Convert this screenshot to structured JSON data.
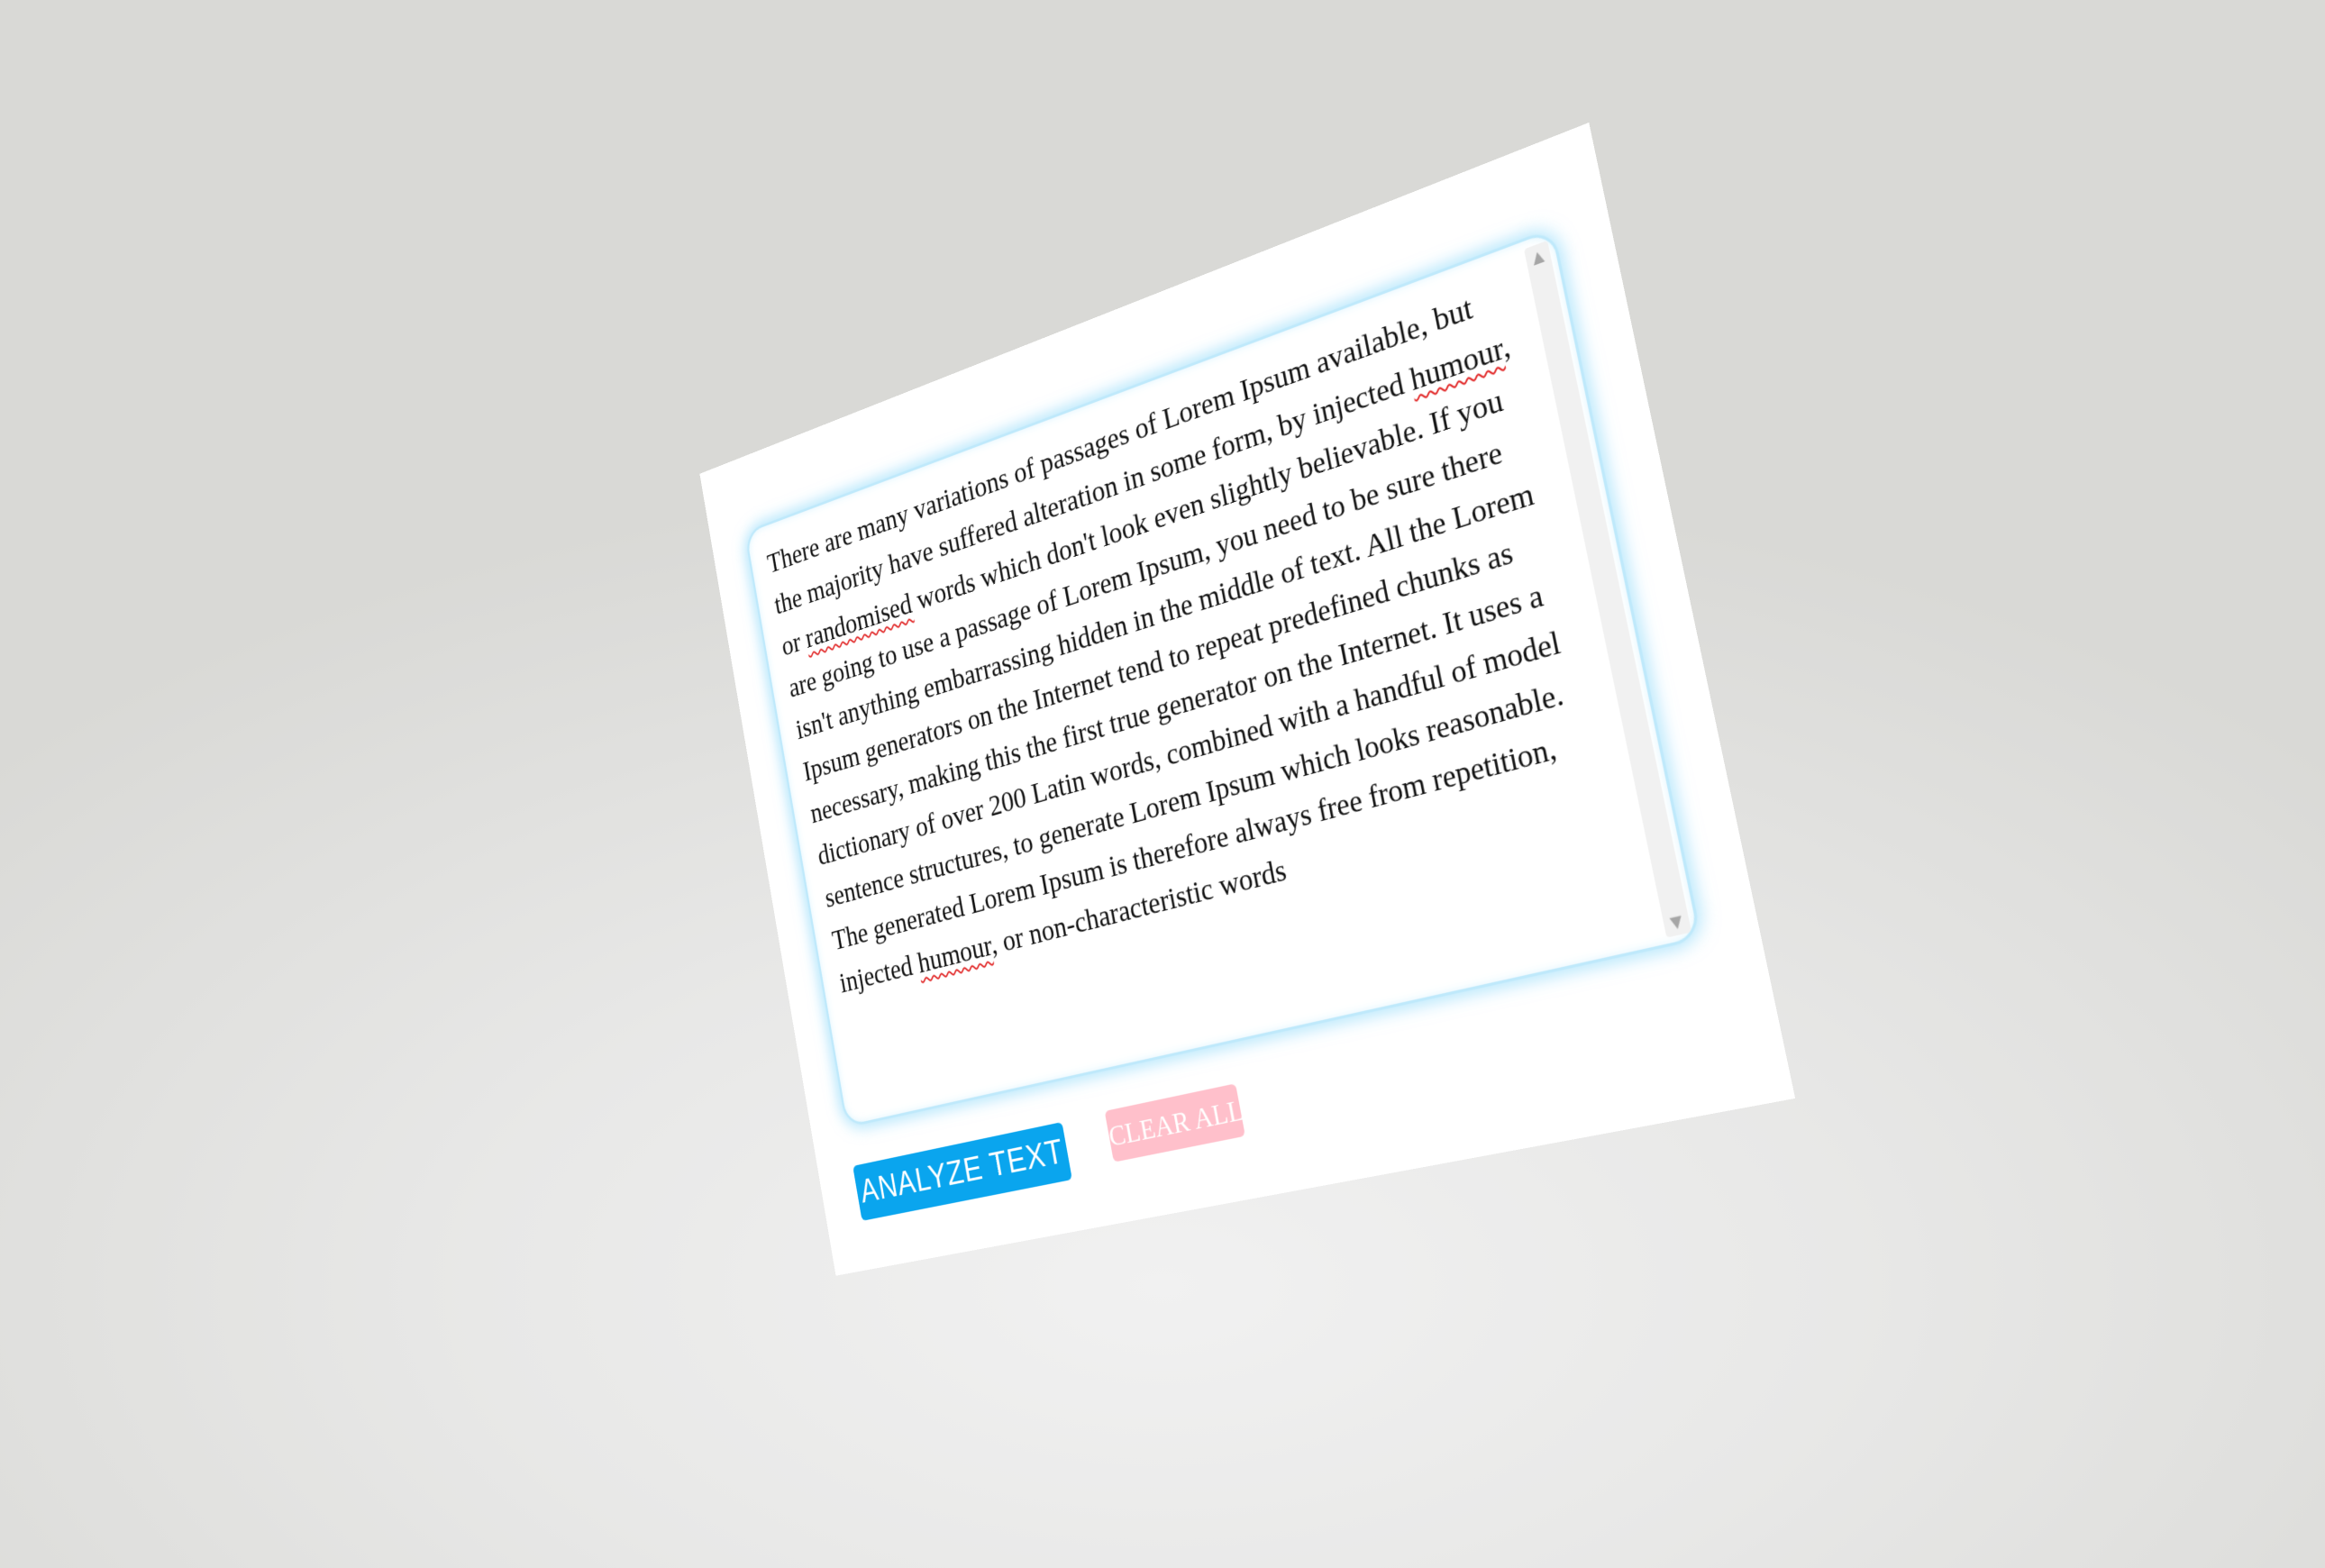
{
  "editor": {
    "segments": [
      "There are many variations of passages of Lorem Ipsum available, but the majority have suffered alteration in some form, by injected ",
      "humour",
      ", or ",
      "randomised",
      " words which don't look even slightly believable. If you are going to use a passage of Lorem Ipsum, you need to be sure there isn't anything embarrassing hidden in the middle of text. All the Lorem Ipsum generators on the Internet tend to repeat predefined chunks as necessary, making this the first true generator on the Internet. It uses a dictionary of over 200 Latin words, combined with a handful of model sentence structures, to generate Lorem Ipsum which looks reasonable. The generated Lorem Ipsum is therefore always free from repetition, injected ",
      "humour",
      ", or non-characteristic words"
    ],
    "scroll_up_icon": "triangle-up",
    "scroll_down_icon": "triangle-down"
  },
  "actions": {
    "analyze_label": "ANALYZE TEXT",
    "clear_label": "CLEAR ALL"
  },
  "colors": {
    "analyze_button": "#0aa5ee",
    "clear_button": "#ffc0cb",
    "editor_glow": "#7fd2fa",
    "spellcheck_underline": "#e02020"
  }
}
